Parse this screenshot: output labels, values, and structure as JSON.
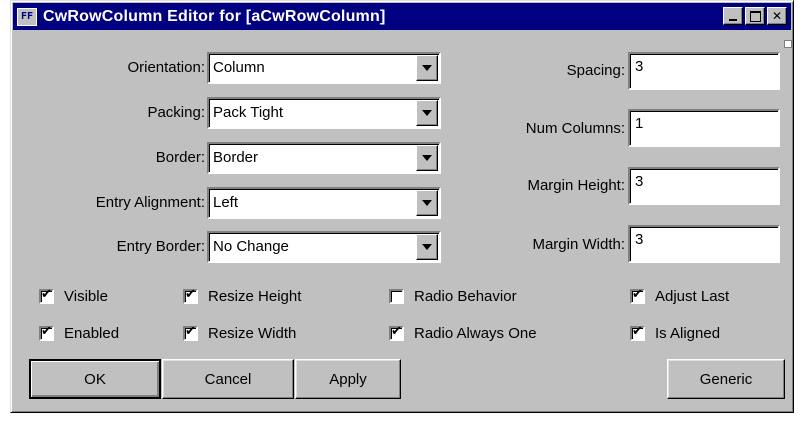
{
  "window": {
    "title": "CwRowColumn Editor for [aCwRowColumn]",
    "icon_text": "FF",
    "buttons": [
      "minimize-icon",
      "maximize-icon",
      "close-icon"
    ]
  },
  "left_fields": [
    {
      "label": "Orientation:",
      "value": "Column"
    },
    {
      "label": "Packing:",
      "value": "Pack Tight"
    },
    {
      "label": "Border:",
      "value": "Border"
    },
    {
      "label": "Entry Alignment:",
      "value": "Left"
    },
    {
      "label": "Entry Border:",
      "value": "No Change"
    }
  ],
  "right_fields": [
    {
      "label": "Spacing:",
      "value": "3"
    },
    {
      "label": "Num Columns:",
      "value": "1"
    },
    {
      "label": "Margin Height:",
      "value": "3"
    },
    {
      "label": "Margin Width:",
      "value": "3"
    }
  ],
  "checkboxes": [
    {
      "label": "Visible",
      "checked": true
    },
    {
      "label": "Resize Height",
      "checked": true
    },
    {
      "label": "Radio Behavior",
      "checked": false
    },
    {
      "label": "Adjust Last",
      "checked": true
    },
    {
      "label": "Enabled",
      "checked": true
    },
    {
      "label": "Resize Width",
      "checked": true
    },
    {
      "label": "Radio Always One",
      "checked": true
    },
    {
      "label": "Is Aligned",
      "checked": true
    }
  ],
  "buttons": {
    "ok": "OK",
    "cancel": "Cancel",
    "apply": "Apply",
    "generic": "Generic"
  }
}
